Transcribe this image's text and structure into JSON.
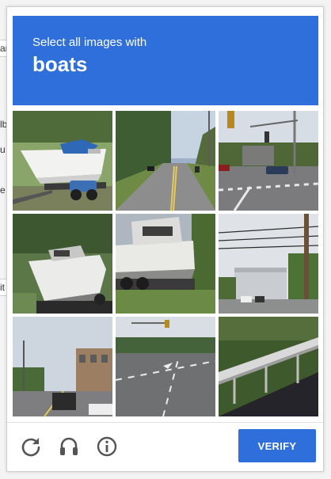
{
  "background_page": {
    "fragments": [
      "ar",
      "lb",
      "u",
      "e",
      "it"
    ]
  },
  "captcha": {
    "instruction": "Select all images with",
    "keyword": "boats",
    "tiles": [
      {
        "subject": "sailboat on trailer with blue cover"
      },
      {
        "subject": "two-lane road through trees"
      },
      {
        "subject": "intersection with traffic lights"
      },
      {
        "subject": "motorboat on trailer"
      },
      {
        "subject": "motorboat on trailer by hedge"
      },
      {
        "subject": "building with utility pole"
      },
      {
        "subject": "town street with buildings"
      },
      {
        "subject": "multi-lane road with trees"
      },
      {
        "subject": "road with guardrail"
      }
    ],
    "verify_label": "VERIFY",
    "colors": {
      "accent": "#2e6fdb"
    },
    "icons": [
      "reload-icon",
      "audio-challenge-icon",
      "info-icon"
    ]
  }
}
